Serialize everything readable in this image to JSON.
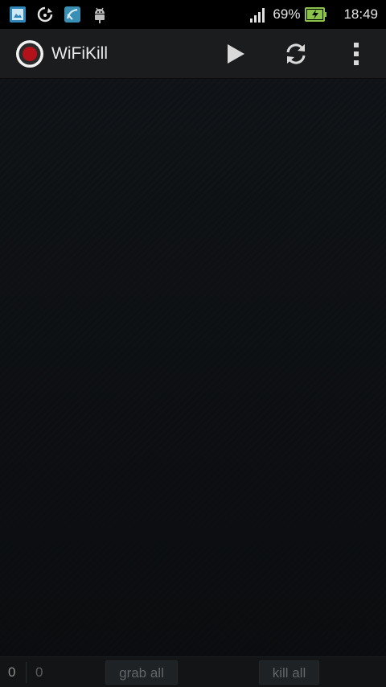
{
  "status_bar": {
    "battery_percent": "69%",
    "time": "18:49",
    "icons": [
      "photo-notification-icon",
      "sync-notification-icon",
      "app-notification-icon",
      "android-debug-icon",
      "signal-icon",
      "battery-charging-icon"
    ]
  },
  "action_bar": {
    "title": "WiFiKill",
    "logo_icon": "record-logo-icon",
    "actions": [
      "play-icon",
      "refresh-icon",
      "overflow-menu-icon"
    ]
  },
  "footer": {
    "count_left": "0",
    "count_right": "0",
    "grab_all_label": "grab all",
    "kill_all_label": "kill all"
  }
}
